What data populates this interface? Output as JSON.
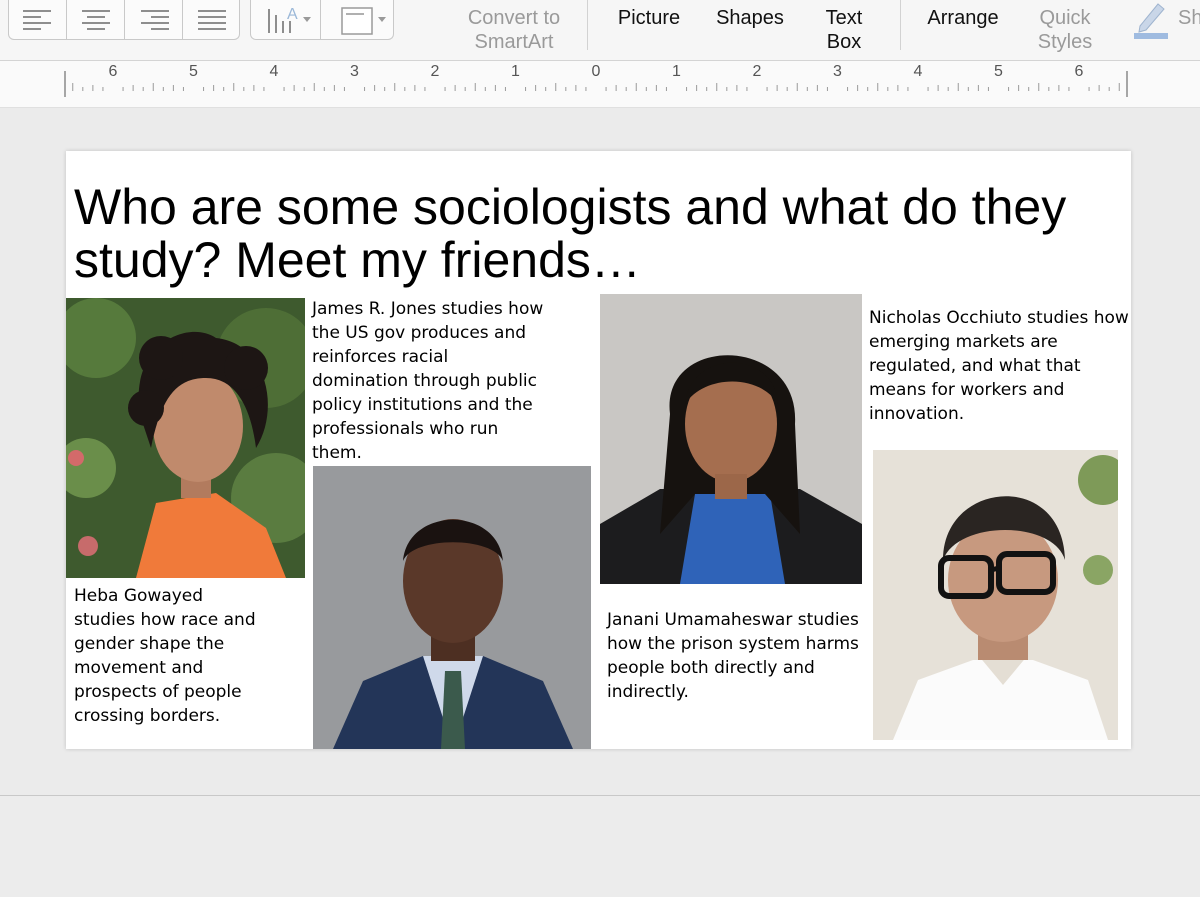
{
  "toolbar": {
    "align_buttons": [
      "align-left-icon",
      "align-center-icon",
      "align-right-icon",
      "justify-icon"
    ],
    "text_direction_icon": "text-direction-icon",
    "text_box_icon": "text-box-format-icon",
    "convert_smartart": {
      "line1": "Convert to",
      "line2": "SmartArt"
    },
    "picture": "Picture",
    "shapes": "Shapes",
    "text_box": {
      "line1": "Text",
      "line2": "Box"
    },
    "arrange": "Arrange",
    "quick_styles": {
      "line1": "Quick",
      "line2": "Styles"
    },
    "shape_fill_partial": "Sh"
  },
  "ruler": {
    "left_numbers": [
      "6",
      "5",
      "4",
      "3",
      "2",
      "1"
    ],
    "center": "0",
    "right_numbers": [
      "1",
      "2",
      "3",
      "4",
      "5",
      "6"
    ]
  },
  "slide": {
    "title": "Who are some sociologists and what do they study? Meet my friends…",
    "people": [
      {
        "name": "Heba Gowayed",
        "caption_lines": [
          "Heba Gowayed",
          "studies how race and",
          "gender shape the",
          "movement and",
          "prospects of people",
          "crossing borders."
        ]
      },
      {
        "name": "James R. Jones",
        "caption_lines": [
          "James R. Jones studies how",
          "the US gov produces and",
          "reinforces racial",
          "domination through public",
          "policy institutions and the",
          "professionals who run",
          "them."
        ]
      },
      {
        "name": "Janani Umamaheswar",
        "caption_lines": [
          "Janani Umamaheswar studies",
          "how the prison system harms",
          "people both directly and",
          "indirectly."
        ]
      },
      {
        "name": "Nicholas Occhiuto",
        "caption_lines": [
          "Nicholas Occhiuto studies how",
          "emerging markets are",
          "regulated, and what that",
          "means for workers and",
          "innovation."
        ]
      }
    ]
  },
  "colors": {
    "canvas": "#ebebeb",
    "toolbar": "#f6f6f6",
    "slide": "#ffffff",
    "accent_pencil": "#3478c6"
  }
}
